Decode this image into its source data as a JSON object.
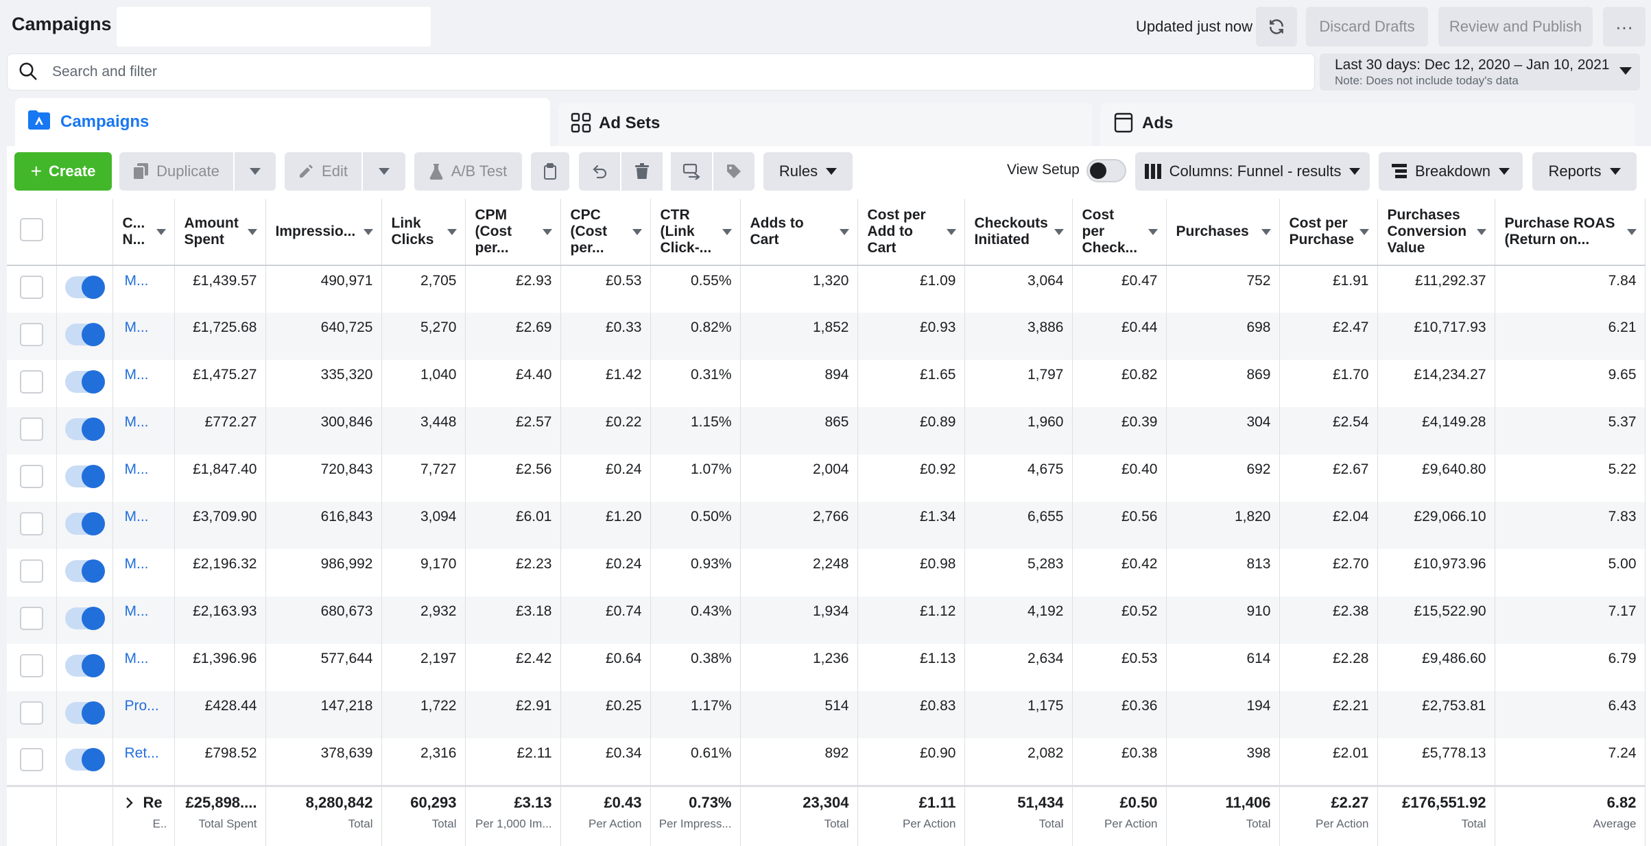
{
  "header": {
    "title": "Campaigns",
    "updated_text": "Updated just now",
    "discard_label": "Discard Drafts",
    "publish_label": "Review and Publish",
    "more_label": "···"
  },
  "search": {
    "placeholder": "Search and filter"
  },
  "date_filter": {
    "range": "Last 30 days: Dec 12, 2020 – Jan 10, 2021",
    "note": "Note: Does not include today's data"
  },
  "tabs": [
    {
      "label": "Campaigns"
    },
    {
      "label": "Ad Sets"
    },
    {
      "label": "Ads"
    }
  ],
  "toolbar": {
    "create_label": "Create",
    "duplicate_label": "Duplicate",
    "edit_label": "Edit",
    "ab_test_label": "A/B Test",
    "rules_label": "Rules",
    "view_setup_label": "View Setup",
    "columns_label": "Columns: Funnel - results",
    "breakdown_label": "Breakdown",
    "reports_label": "Reports"
  },
  "table": {
    "columns": [
      "C... N...",
      "Amount Spent",
      "Impressio...",
      "Link Clicks",
      "CPM (Cost per...",
      "CPC (Cost per...",
      "CTR (Link Click-...",
      "Adds to Cart",
      "Cost per Add to Cart",
      "Checkouts Initiated",
      "Cost per Check... Initiated",
      "Purchases",
      "Cost per Purchase",
      "Purchases Conversion Value",
      "Purchase ROAS (Return on..."
    ],
    "rows": [
      {
        "name": "M...",
        "cells": [
          "£1,439.57",
          "490,971",
          "2,705",
          "£2.93",
          "£0.53",
          "0.55%",
          "1,320",
          "£1.09",
          "3,064",
          "£0.47",
          "752",
          "£1.91",
          "£11,292.37",
          "7.84"
        ]
      },
      {
        "name": "M...",
        "cells": [
          "£1,725.68",
          "640,725",
          "5,270",
          "£2.69",
          "£0.33",
          "0.82%",
          "1,852",
          "£0.93",
          "3,886",
          "£0.44",
          "698",
          "£2.47",
          "£10,717.93",
          "6.21"
        ]
      },
      {
        "name": "M...",
        "cells": [
          "£1,475.27",
          "335,320",
          "1,040",
          "£4.40",
          "£1.42",
          "0.31%",
          "894",
          "£1.65",
          "1,797",
          "£0.82",
          "869",
          "£1.70",
          "£14,234.27",
          "9.65"
        ]
      },
      {
        "name": "M...",
        "cells": [
          "£772.27",
          "300,846",
          "3,448",
          "£2.57",
          "£0.22",
          "1.15%",
          "865",
          "£0.89",
          "1,960",
          "£0.39",
          "304",
          "£2.54",
          "£4,149.28",
          "5.37"
        ]
      },
      {
        "name": "M...",
        "cells": [
          "£1,847.40",
          "720,843",
          "7,727",
          "£2.56",
          "£0.24",
          "1.07%",
          "2,004",
          "£0.92",
          "4,675",
          "£0.40",
          "692",
          "£2.67",
          "£9,640.80",
          "5.22"
        ]
      },
      {
        "name": "M...",
        "cells": [
          "£3,709.90",
          "616,843",
          "3,094",
          "£6.01",
          "£1.20",
          "0.50%",
          "2,766",
          "£1.34",
          "6,655",
          "£0.56",
          "1,820",
          "£2.04",
          "£29,066.10",
          "7.83"
        ]
      },
      {
        "name": "M...",
        "cells": [
          "£2,196.32",
          "986,992",
          "9,170",
          "£2.23",
          "£0.24",
          "0.93%",
          "2,248",
          "£0.98",
          "5,283",
          "£0.42",
          "813",
          "£2.70",
          "£10,973.96",
          "5.00"
        ]
      },
      {
        "name": "M...",
        "cells": [
          "£2,163.93",
          "680,673",
          "2,932",
          "£3.18",
          "£0.74",
          "0.43%",
          "1,934",
          "£1.12",
          "4,192",
          "£0.52",
          "910",
          "£2.38",
          "£15,522.90",
          "7.17"
        ]
      },
      {
        "name": "M...",
        "cells": [
          "£1,396.96",
          "577,644",
          "2,197",
          "£2.42",
          "£0.64",
          "0.38%",
          "1,236",
          "£1.13",
          "2,634",
          "£0.53",
          "614",
          "£2.28",
          "£9,486.60",
          "6.79"
        ]
      },
      {
        "name": "Pro...",
        "cells": [
          "£428.44",
          "147,218",
          "1,722",
          "£2.91",
          "£0.25",
          "1.17%",
          "514",
          "£0.83",
          "1,175",
          "£0.36",
          "194",
          "£2.21",
          "£2,753.81",
          "6.43"
        ]
      },
      {
        "name": "Ret...",
        "cells": [
          "£798.52",
          "378,639",
          "2,316",
          "£2.11",
          "£0.34",
          "0.61%",
          "892",
          "£0.90",
          "2,082",
          "£0.38",
          "398",
          "£2.01",
          "£5,778.13",
          "7.24"
        ]
      }
    ],
    "footer": {
      "name_value": "Re",
      "name_sub": "E...",
      "cells": [
        {
          "value": "£25,898....",
          "sub": "Total Spent"
        },
        {
          "value": "8,280,842",
          "sub": "Total"
        },
        {
          "value": "60,293",
          "sub": "Total"
        },
        {
          "value": "£3.13",
          "sub": "Per 1,000 Im..."
        },
        {
          "value": "£0.43",
          "sub": "Per Action"
        },
        {
          "value": "0.73%",
          "sub": "Per Impress..."
        },
        {
          "value": "23,304",
          "sub": "Total"
        },
        {
          "value": "£1.11",
          "sub": "Per Action"
        },
        {
          "value": "51,434",
          "sub": "Total"
        },
        {
          "value": "£0.50",
          "sub": "Per Action"
        },
        {
          "value": "11,406",
          "sub": "Total"
        },
        {
          "value": "£2.27",
          "sub": "Per Action"
        },
        {
          "value": "£176,551.92",
          "sub": "Total"
        },
        {
          "value": "6.82",
          "sub": "Average"
        }
      ]
    }
  },
  "colors": {
    "accent": "#1877f2",
    "create_green": "#42b72a",
    "link_blue": "#216fdb"
  }
}
